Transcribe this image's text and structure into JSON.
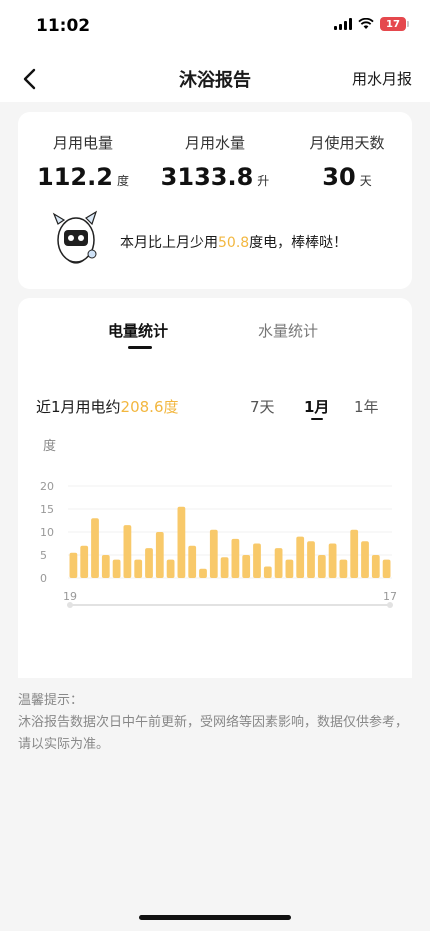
{
  "status_bar": {
    "time": "11:02",
    "battery": "17"
  },
  "nav": {
    "title": "沐浴报告",
    "action": "用水月报"
  },
  "summary": {
    "stats": [
      {
        "label": "月用电量",
        "value": "112.2",
        "unit": "度"
      },
      {
        "label": "月用水量",
        "value": "3133.8",
        "unit": "升"
      },
      {
        "label": "月使用天数",
        "value": "30",
        "unit": "天"
      }
    ],
    "tip_prefix": "本月比上月少用",
    "tip_value": "50.8",
    "tip_suffix": "度电，棒棒哒！"
  },
  "chart_section": {
    "tabs": [
      "电量统计",
      "水量统计"
    ],
    "active_tab": "电量统计",
    "summary_prefix": "近1月用电约",
    "summary_value": "208.6度",
    "ranges": [
      "7天",
      "1月",
      "1年"
    ],
    "active_range": "1月"
  },
  "chart_data": {
    "type": "bar",
    "ylabel": "度",
    "ylim": [
      0,
      20
    ],
    "yticks": [
      "20",
      "15",
      "10",
      "5",
      "0"
    ],
    "x_start_label": "19",
    "x_end_label": "17",
    "values": [
      5.5,
      7,
      13,
      5,
      4,
      11.5,
      4,
      6.5,
      10,
      4,
      15.5,
      7,
      2,
      10.5,
      4.5,
      8.5,
      5,
      7.5,
      2.5,
      6.5,
      4,
      9,
      8,
      5,
      7.5,
      4,
      10.5,
      8,
      5,
      4
    ],
    "bar_color": "#f8c96a"
  },
  "footer": {
    "title": "温馨提示：",
    "text": "沐浴报告数据次日中午前更新，受网络等因素影响，数据仅供参考，请以实际为准。"
  },
  "colors": {
    "accent": "#f2b740",
    "background": "#f5f5f5"
  }
}
